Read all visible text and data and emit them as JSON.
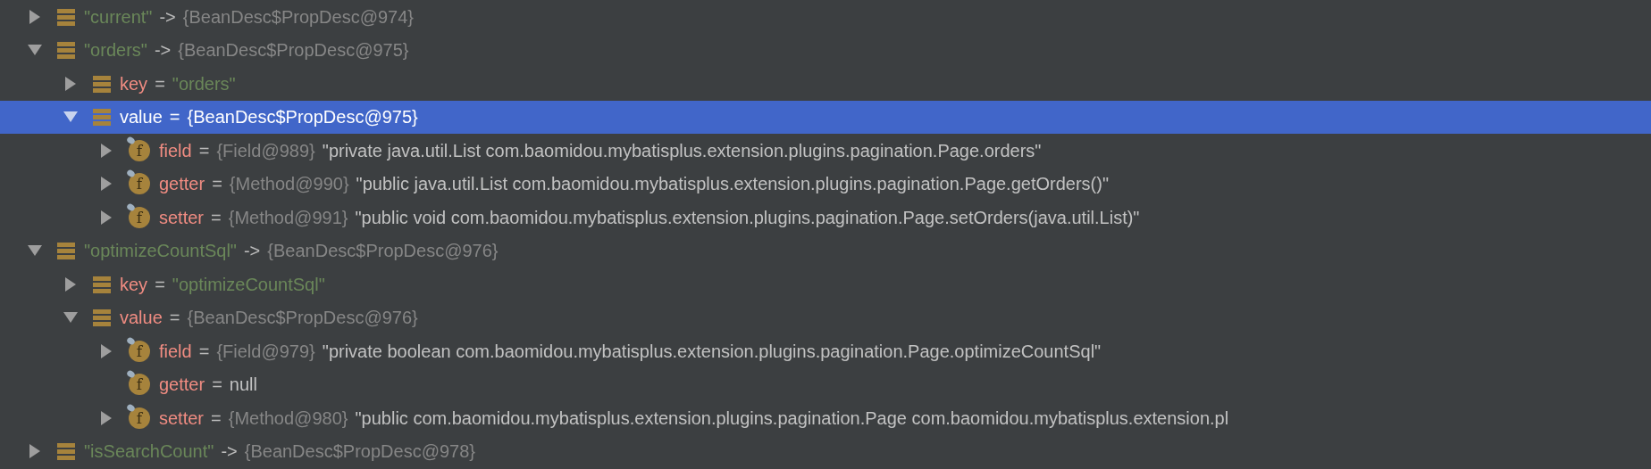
{
  "tree": [
    {
      "kind": "entry",
      "name": "\"current\"",
      "separator": "->",
      "ref": "{BeanDesc$PropDesc@974}",
      "expanded": false,
      "selected": false
    },
    {
      "kind": "entry",
      "name": "\"orders\"",
      "separator": "->",
      "ref": "{BeanDesc$PropDesc@975}",
      "expanded": true,
      "selected": false,
      "children": [
        {
          "kind": "key",
          "name": "key",
          "separator": "=",
          "value": "\"orders\"",
          "expanded": false,
          "selected": false
        },
        {
          "kind": "value",
          "name": "value",
          "separator": "=",
          "ref": "{BeanDesc$PropDesc@975}",
          "expanded": true,
          "selected": true,
          "children": [
            {
              "kind": "field",
              "icon_letter": "f",
              "name": "field",
              "separator": "=",
              "ref": "{Field@989}",
              "value": "\"private java.util.List com.baomidou.mybatisplus.extension.plugins.pagination.Page.orders\"",
              "expanded": false,
              "selected": false
            },
            {
              "kind": "field",
              "icon_letter": "f",
              "name": "getter",
              "separator": "=",
              "ref": "{Method@990}",
              "value": "\"public java.util.List com.baomidou.mybatisplus.extension.plugins.pagination.Page.getOrders()\"",
              "expanded": false,
              "selected": false
            },
            {
              "kind": "field",
              "icon_letter": "f",
              "name": "setter",
              "separator": "=",
              "ref": "{Method@991}",
              "value": "\"public void com.baomidou.mybatisplus.extension.plugins.pagination.Page.setOrders(java.util.List)\"",
              "expanded": false,
              "selected": false
            }
          ]
        }
      ]
    },
    {
      "kind": "entry",
      "name": "\"optimizeCountSql\"",
      "separator": "->",
      "ref": "{BeanDesc$PropDesc@976}",
      "expanded": true,
      "selected": false,
      "children": [
        {
          "kind": "key",
          "name": "key",
          "separator": "=",
          "value": "\"optimizeCountSql\"",
          "expanded": false,
          "selected": false
        },
        {
          "kind": "value",
          "name": "value",
          "separator": "=",
          "ref": "{BeanDesc$PropDesc@976}",
          "expanded": true,
          "selected": false,
          "children": [
            {
              "kind": "field",
              "icon_letter": "f",
              "name": "field",
              "separator": "=",
              "ref": "{Field@979}",
              "value": "\"private boolean com.baomidou.mybatisplus.extension.plugins.pagination.Page.optimizeCountSql\"",
              "expanded": false,
              "selected": false
            },
            {
              "kind": "leaf",
              "icon_letter": "f",
              "name": "getter",
              "separator": "=",
              "value": "null",
              "selected": false
            },
            {
              "kind": "field",
              "icon_letter": "f",
              "name": "setter",
              "separator": "=",
              "ref": "{Method@980}",
              "value": "\"public com.baomidou.mybatisplus.extension.plugins.pagination.Page com.baomidou.mybatisplus.extension.pl",
              "expanded": false,
              "selected": false
            }
          ]
        }
      ]
    },
    {
      "kind": "entry",
      "name": "\"isSearchCount\"",
      "separator": "->",
      "ref": "{BeanDesc$PropDesc@978}",
      "expanded": false,
      "selected": false
    }
  ]
}
